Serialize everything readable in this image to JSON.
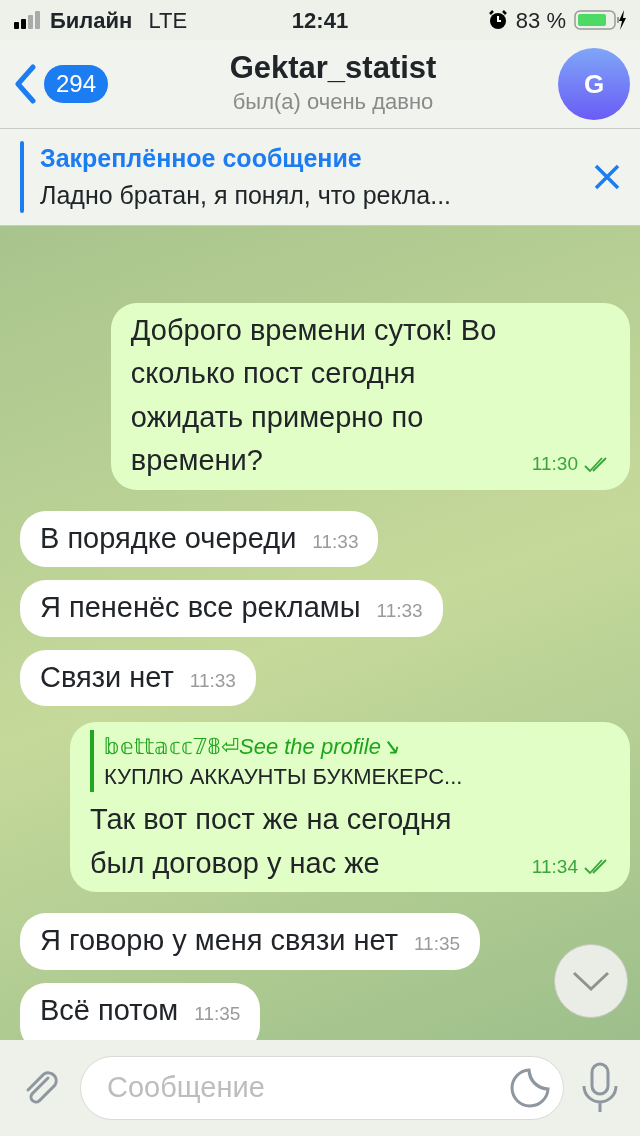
{
  "status_bar": {
    "carrier": "Билайн",
    "network": "LTE",
    "time": "12:41",
    "battery": {
      "text": "83 %",
      "charging": true
    }
  },
  "header": {
    "back_count": "294",
    "title": "Gektar_statist",
    "subtitle": "был(а) очень давно",
    "avatar_letter": "G"
  },
  "pinned": {
    "label": "Закреплённое сообщение",
    "text": "Ладно братан, я понял, что рекла..."
  },
  "messages": [
    {
      "kind": "out",
      "text": "Доброго времени суток! Во сколько пост сегодня ожидать примерно по времени?",
      "time": "11:30",
      "read": true
    },
    {
      "kind": "in",
      "text": "В порядке очереди",
      "time": "11:33"
    },
    {
      "kind": "in",
      "text": "Я пененёс все рекламы",
      "time": "11:33"
    },
    {
      "kind": "in",
      "text": "Связи нет",
      "time": "11:33"
    },
    {
      "kind": "out",
      "reply": {
        "author": "𝕓𝕖𝕥𝕥𝕒𝕔𝕔𝟟𝟠⏎*See the profile↘*",
        "text": "КУПЛЮ АККАУНТЫ БУКМЕКЕРС..."
      },
      "text": "Так вот пост же на сегодня был договор у нас же",
      "time": "11:34",
      "read": true
    },
    {
      "kind": "in",
      "text": "Я говорю у меня связи нет",
      "time": "11:35"
    },
    {
      "kind": "in",
      "text": "Всё потом",
      "time": "11:35"
    }
  ],
  "input": {
    "placeholder": "Сообщение"
  }
}
